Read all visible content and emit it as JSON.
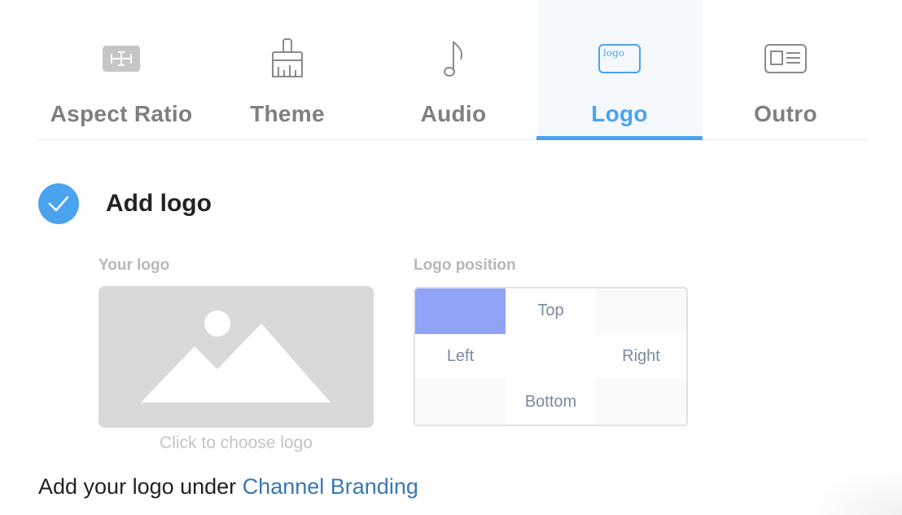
{
  "tabs": [
    {
      "label": "Aspect Ratio",
      "icon": "aspect-ratio-icon",
      "active": false
    },
    {
      "label": "Theme",
      "icon": "paintbrush-icon",
      "active": false
    },
    {
      "label": "Audio",
      "icon": "music-note-icon",
      "active": false
    },
    {
      "label": "Logo",
      "icon": "logo-icon",
      "active": true,
      "icon_text": "logo"
    },
    {
      "label": "Outro",
      "icon": "outro-icon",
      "active": false
    }
  ],
  "add_logo": {
    "label": "Add logo",
    "checked": true
  },
  "your_logo": {
    "label": "Your logo",
    "hint": "Click to choose logo"
  },
  "logo_position": {
    "label": "Logo position",
    "cells": [
      "",
      "Top",
      "",
      "Left",
      "",
      "Right",
      "",
      "Bottom",
      ""
    ],
    "selected": "top-left"
  },
  "footer": {
    "text": "Add your logo under ",
    "link": "Channel Branding"
  },
  "colors": {
    "accent": "#4aa3ef",
    "selected_cell": "#8fa3f7",
    "link": "#3a78b4"
  }
}
